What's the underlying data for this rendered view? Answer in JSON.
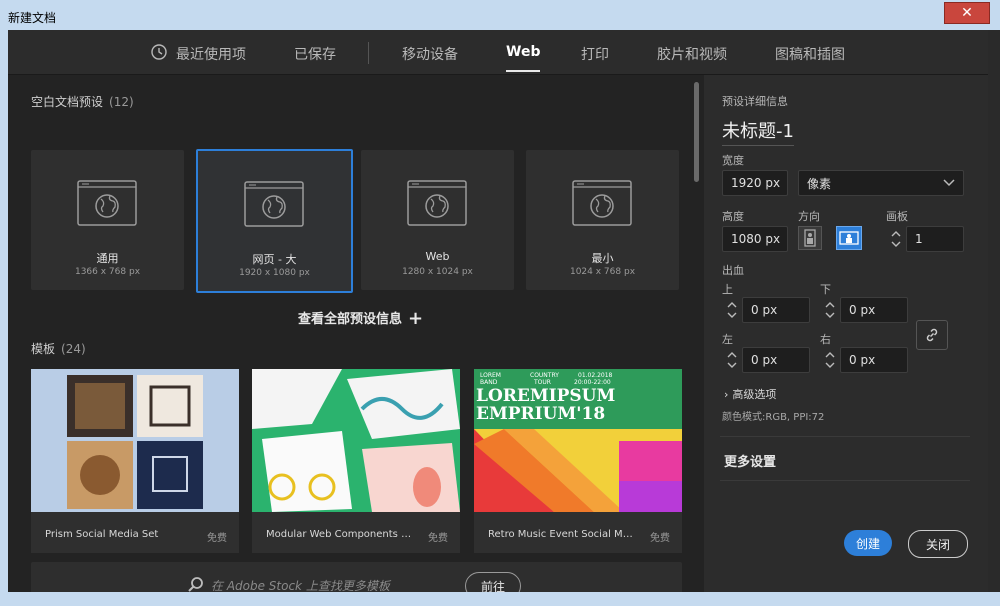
{
  "window": {
    "title": "新建文档",
    "close_glyph": "✕"
  },
  "tabs": [
    {
      "label": "最近使用项"
    },
    {
      "label": "已保存"
    },
    {
      "label": "移动设备"
    },
    {
      "label": "Web"
    },
    {
      "label": "打印"
    },
    {
      "label": "胶片和视频"
    },
    {
      "label": "图稿和插图"
    }
  ],
  "presets": {
    "label": "空白文档预设",
    "count": "(12)",
    "items": [
      {
        "name": "通用",
        "size": "1366 x 768 px"
      },
      {
        "name": "网页 - 大",
        "size": "1920 x 1080 px"
      },
      {
        "name": "Web",
        "size": "1280 x 1024 px"
      },
      {
        "name": "最小",
        "size": "1024 x 768 px"
      }
    ],
    "view_all": "查看全部预设信息"
  },
  "templates": {
    "label": "模板",
    "count": "(24)",
    "items": [
      {
        "name": "Prism Social Media Set",
        "badge": "免费"
      },
      {
        "name": "Modular Web Components Set",
        "badge": "免费"
      },
      {
        "name": "Retro Music Event Social Media S...",
        "badge": "免费"
      }
    ],
    "thumb3_text": {
      "l1": "LOREM",
      "l2": "BAND",
      "l3": "COUNTRY",
      "l4": "TOUR",
      "l5": "01.02.2018",
      "l6": "20:00-22:00",
      "big1": "LOREMIPSUM",
      "big2": "EMPRIUM'18"
    }
  },
  "stock": {
    "placeholder": "在 Adobe Stock 上查找更多模板",
    "go_label": "前往"
  },
  "details": {
    "heading": "预设详细信息",
    "doc_name": "未标题-1",
    "width_label": "宽度",
    "width_value": "1920 px",
    "unit": "像素",
    "height_label": "高度",
    "height_value": "1080 px",
    "orientation_label": "方向",
    "artboard_label": "画板",
    "artboard_value": "1",
    "bleed_label": "出血",
    "top_label": "上",
    "top_value": "0 px",
    "bottom_label": "下",
    "bottom_value": "0 px",
    "left_label": "左",
    "left_value": "0 px",
    "right_label": "右",
    "right_value": "0 px",
    "advanced": "高级选项",
    "color_mode": "颜色模式:RGB, PPI:72",
    "more_settings": "更多设置",
    "create_label": "创建",
    "close_label": "关闭"
  },
  "colors": {
    "accent": "#2d7fd9",
    "panel": "#2c2c2c",
    "background": "#232323"
  }
}
